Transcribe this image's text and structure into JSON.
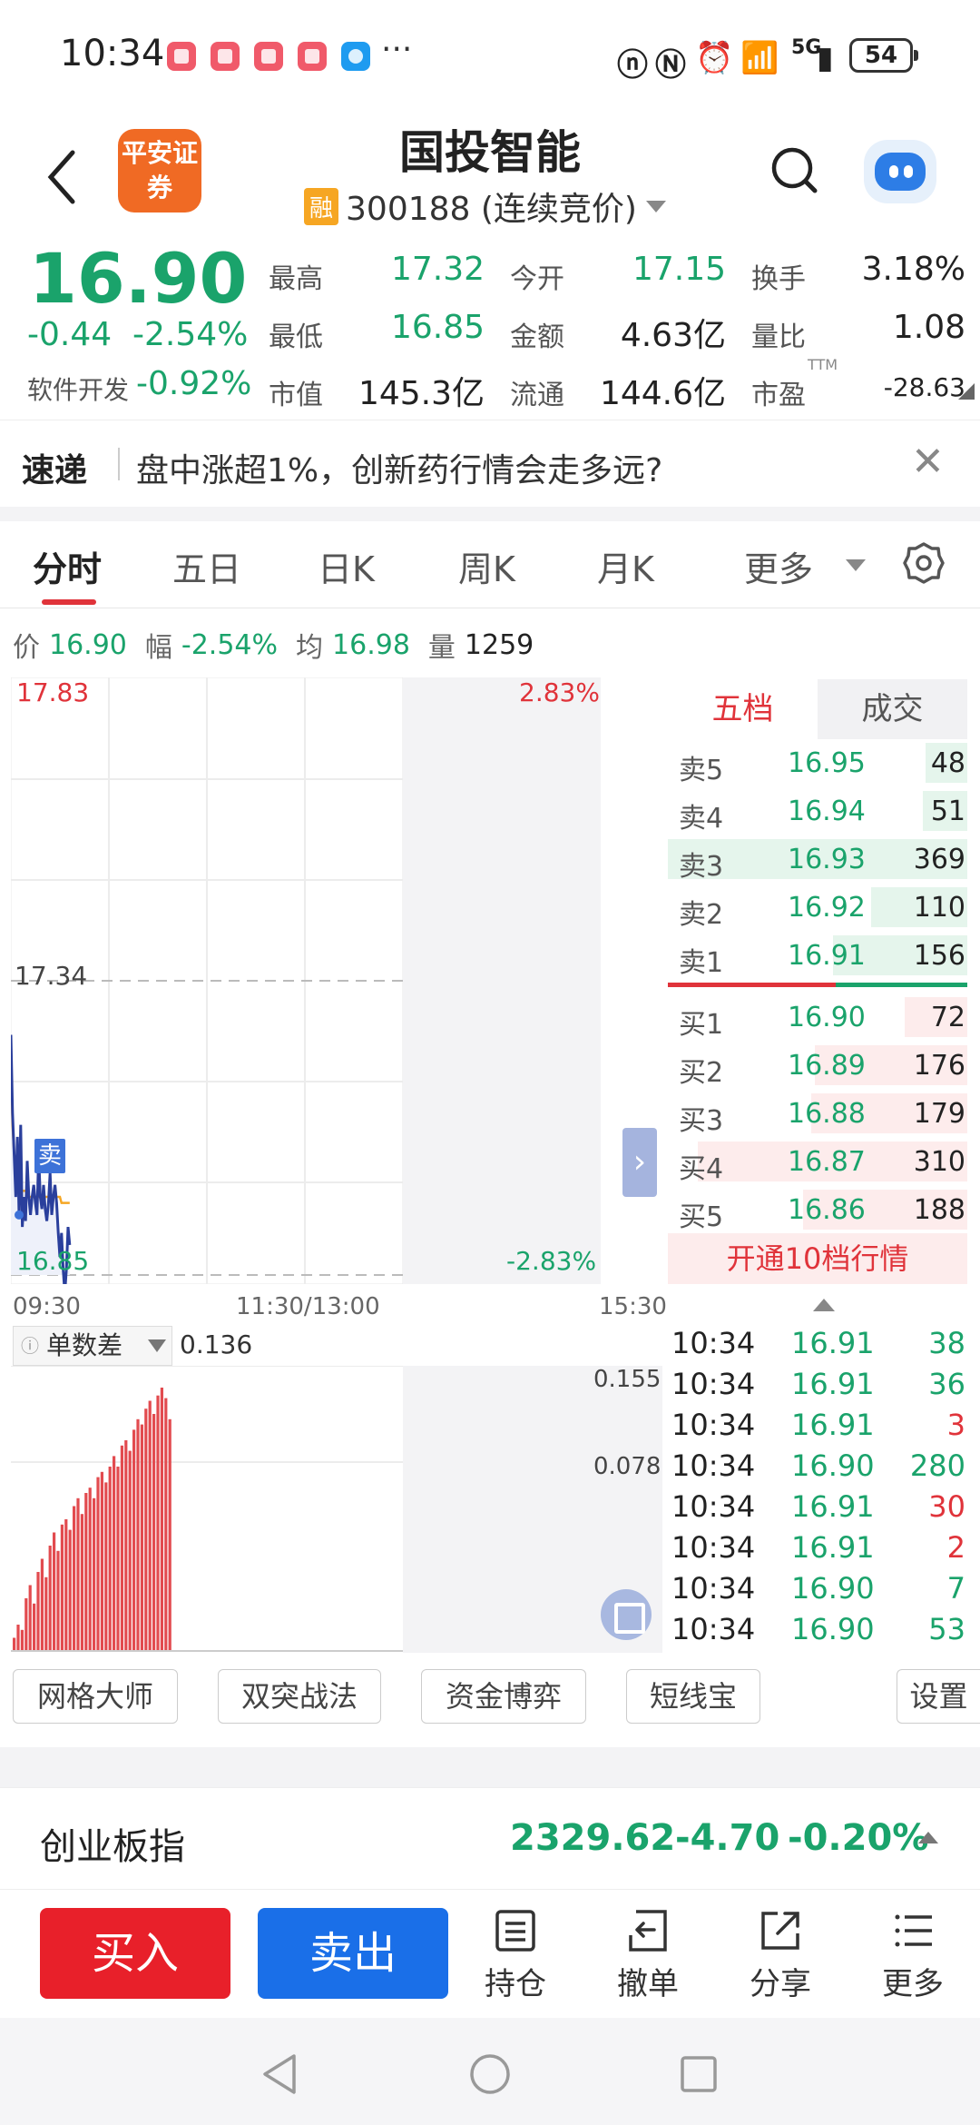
{
  "status_bar": {
    "time": "10:34",
    "more": "···",
    "network": "5G",
    "battery": "54"
  },
  "header": {
    "title": "国投智能",
    "logo_text": "平安证券",
    "margin_tag": "融",
    "code_status": "300188 (连续竞价)"
  },
  "quote": {
    "price": "16.90",
    "change": "-0.44",
    "change_pct": "-2.54%",
    "sector": "软件开发",
    "sector_pct": "-0.92%",
    "fields": [
      {
        "label": "最高",
        "value": "17.32",
        "color": "#1aa36b"
      },
      {
        "label": "今开",
        "value": "17.15",
        "color": "#1aa36b"
      },
      {
        "label": "换手",
        "value": "3.18%",
        "color": "#222"
      },
      {
        "label": "最低",
        "value": "16.85",
        "color": "#1aa36b"
      },
      {
        "label": "金额",
        "value": "4.63亿",
        "color": "#222"
      },
      {
        "label": "量比",
        "value": "1.08",
        "color": "#222"
      },
      {
        "label": "市值",
        "value": "145.3亿",
        "color": "#222"
      },
      {
        "label": "流通",
        "value": "144.6亿",
        "color": "#222"
      },
      {
        "label": "市盈",
        "value": "-28.63",
        "color": "#222"
      }
    ],
    "pe_superscript": "TTM"
  },
  "news": {
    "tag": "速递",
    "text": "盘中涨超1%，创新药行情会走多远?",
    "close": "✕"
  },
  "tabs": [
    "分时",
    "五日",
    "日K",
    "周K",
    "月K",
    "更多"
  ],
  "info_line": {
    "price_label": "价",
    "price": "16.90",
    "range_label": "幅",
    "range": "-2.54%",
    "avg_label": "均",
    "avg": "16.98",
    "vol_label": "量",
    "vol": "1259"
  },
  "chart_data": {
    "type": "line",
    "title": "",
    "y_labels": {
      "top": "17.83",
      "mid": "17.34",
      "bottom": "16.85"
    },
    "pct_labels": {
      "top": "2.83%",
      "bottom": "-2.83%"
    },
    "x_labels": [
      "09:30",
      "11:30/13:00",
      "15:30"
    ],
    "ylim": [
      16.85,
      17.83
    ],
    "reference_price": 17.34,
    "trade_marker": "卖",
    "series": [
      {
        "values": [
          17.25,
          17.12,
          17.05,
          16.98,
          17.08,
          16.95,
          17.1,
          16.93,
          16.98,
          16.94,
          17.04,
          16.98,
          16.95,
          16.98,
          17.0,
          16.97,
          16.95,
          17.05,
          16.98,
          16.96,
          17.0,
          16.96,
          16.94,
          16.97,
          17.02,
          16.95,
          16.98,
          17.0,
          16.97,
          16.92,
          16.88,
          16.92,
          16.86,
          16.82,
          16.86,
          16.93,
          16.9
        ]
      },
      {
        "values": [
          17.22,
          17.1,
          17.05,
          17.02,
          17.01,
          17.0,
          17.0,
          16.99,
          16.99,
          16.99,
          16.99,
          16.98,
          16.98,
          16.98,
          16.98,
          16.98,
          16.98,
          16.98,
          16.98,
          16.98,
          16.98,
          16.98,
          16.98,
          16.98,
          16.98,
          16.98,
          16.98,
          16.98,
          16.98,
          16.98,
          16.98,
          16.97,
          16.97,
          16.97,
          16.97,
          16.97,
          16.97
        ]
      }
    ]
  },
  "order_book": {
    "tabs": [
      "五档",
      "成交"
    ],
    "asks": [
      {
        "label": "卖5",
        "price": "16.95",
        "vol": "48",
        "depth": 0.14
      },
      {
        "label": "卖4",
        "price": "16.94",
        "vol": "51",
        "depth": 0.15
      },
      {
        "label": "卖3",
        "price": "16.93",
        "vol": "369",
        "depth": 1.0
      },
      {
        "label": "卖2",
        "price": "16.92",
        "vol": "110",
        "depth": 0.32
      },
      {
        "label": "卖1",
        "price": "16.91",
        "vol": "156",
        "depth": 0.45
      }
    ],
    "bids": [
      {
        "label": "买1",
        "price": "16.90",
        "vol": "72",
        "depth": 0.21
      },
      {
        "label": "买2",
        "price": "16.89",
        "vol": "176",
        "depth": 0.51
      },
      {
        "label": "买3",
        "price": "16.88",
        "vol": "179",
        "depth": 0.52
      },
      {
        "label": "买4",
        "price": "16.87",
        "vol": "310",
        "depth": 0.9
      },
      {
        "label": "买5",
        "price": "16.86",
        "vol": "188",
        "depth": 0.55
      }
    ],
    "upgrade": "开通10档行情"
  },
  "indicator": {
    "name": "单数差",
    "value": "0.136",
    "high_label": "0.155",
    "mid_label": "0.078",
    "bars": [
      0.05,
      0.1,
      0.08,
      0.2,
      0.25,
      0.18,
      0.3,
      0.35,
      0.28,
      0.4,
      0.45,
      0.38,
      0.48,
      0.5,
      0.46,
      0.55,
      0.58,
      0.52,
      0.6,
      0.62,
      0.58,
      0.66,
      0.68,
      0.64,
      0.7,
      0.74,
      0.7,
      0.78,
      0.8,
      0.76,
      0.84,
      0.88,
      0.86,
      0.92,
      0.95,
      0.9,
      0.97,
      1.0,
      0.96,
      0.88
    ]
  },
  "ticks": [
    {
      "time": "10:34",
      "price": "16.91",
      "vol": "38",
      "color": "#1aa36b"
    },
    {
      "time": "10:34",
      "price": "16.91",
      "vol": "36",
      "color": "#1aa36b"
    },
    {
      "time": "10:34",
      "price": "16.91",
      "vol": "3",
      "color": "#e0333a"
    },
    {
      "time": "10:34",
      "price": "16.90",
      "vol": "280",
      "color": "#1aa36b"
    },
    {
      "time": "10:34",
      "price": "16.91",
      "vol": "30",
      "color": "#e0333a"
    },
    {
      "time": "10:34",
      "price": "16.91",
      "vol": "2",
      "color": "#e0333a"
    },
    {
      "time": "10:34",
      "price": "16.90",
      "vol": "7",
      "color": "#1aa36b"
    },
    {
      "time": "10:34",
      "price": "16.90",
      "vol": "53",
      "color": "#1aa36b"
    }
  ],
  "tools": [
    "网格大师",
    "双突战法",
    "资金博弈",
    "短线宝",
    "设置"
  ],
  "index_bar": {
    "name": "创业板指",
    "value": "2329.62",
    "change": "-4.70",
    "pct": "-0.20%"
  },
  "actions": {
    "buy": "买入",
    "sell": "卖出",
    "holdings": "持仓",
    "cancel": "撤单",
    "share": "分享",
    "more": "更多"
  },
  "colors": {
    "up": "#e0333a",
    "down": "#1aa36b",
    "buy_button": "#e8202a",
    "sell_button": "#1a6fe8",
    "price_line": "#2a3f9c",
    "avg_line": "#f5a623"
  }
}
